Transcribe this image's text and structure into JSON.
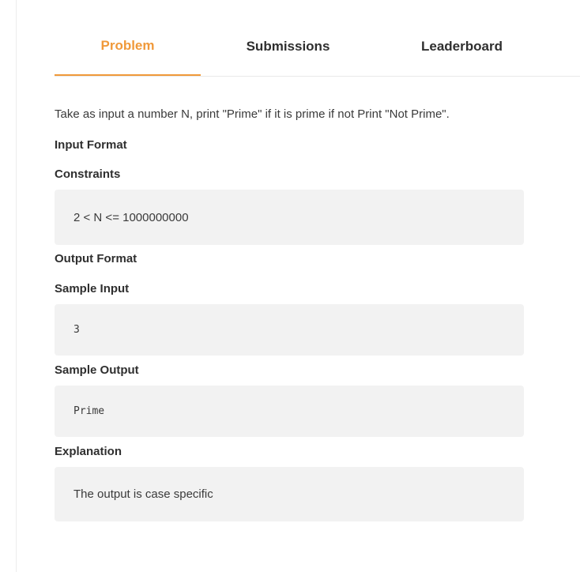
{
  "tabs": [
    {
      "label": "Problem",
      "active": true
    },
    {
      "label": "Submissions",
      "active": false
    },
    {
      "label": "Leaderboard",
      "active": false
    }
  ],
  "accent_color": "#f0993a",
  "problem": {
    "description": "Take as input a number N, print \"Prime\" if it is prime if not Print \"Not Prime\".",
    "input_format_heading": "Input Format",
    "constraints_heading": "Constraints",
    "constraints_text": "2 < N <= 1000000000",
    "output_format_heading": "Output Format",
    "sample_input_heading": "Sample Input",
    "sample_input_text": "3",
    "sample_output_heading": "Sample Output",
    "sample_output_text": "Prime",
    "explanation_heading": "Explanation",
    "explanation_text": "The output is case specific"
  }
}
